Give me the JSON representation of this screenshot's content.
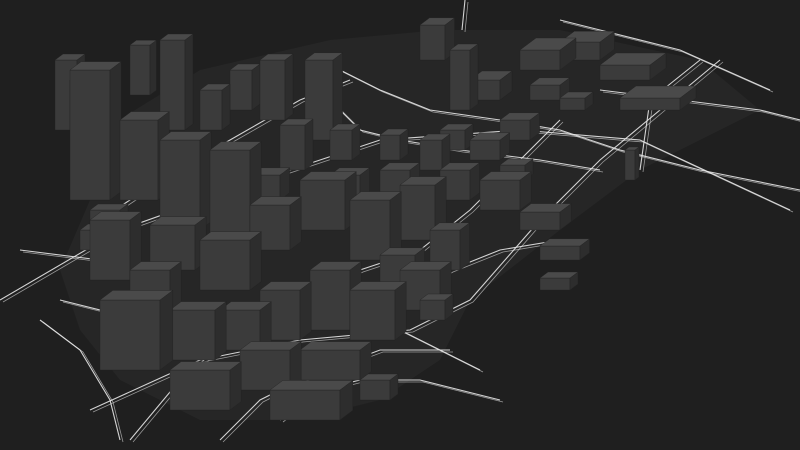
{
  "scene": {
    "kind": "3d-city-map-render",
    "colors": {
      "background": "#1f1f1f",
      "ground": "#262626",
      "roads": "#e8e8e8",
      "building_front": "#3b3b3b",
      "building_side": "#2d2d2d",
      "building_top": "#4a4a4a"
    }
  }
}
